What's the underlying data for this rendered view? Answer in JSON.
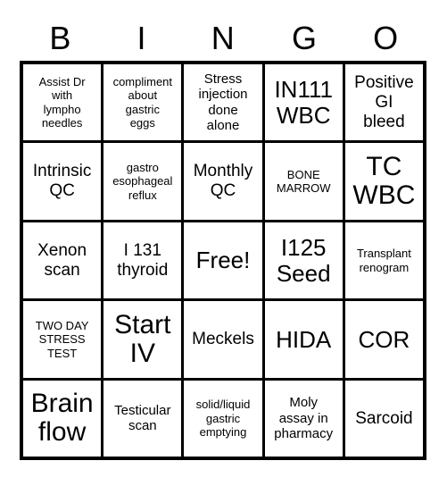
{
  "card": {
    "type": "bingo-card",
    "columns": 5,
    "rows": 5,
    "header": {
      "letters": [
        "B",
        "I",
        "N",
        "G",
        "O"
      ]
    },
    "colors": {
      "background": "#ffffff",
      "border": "#000000",
      "text": "#000000"
    },
    "free_space": {
      "label": "Free!",
      "row": 2,
      "column": 2
    },
    "cells": [
      [
        {
          "label": "Assist Dr\nwith\nlympho\nneedles",
          "size": "xs"
        },
        {
          "label": "compliment\nabout\ngastric\neggs",
          "size": "xs"
        },
        {
          "label": "Stress\ninjection\ndone\nalone",
          "size": "sm"
        },
        {
          "label": "IN111\nWBC",
          "size": "lg"
        },
        {
          "label": "Positive\nGI\nbleed",
          "size": "md"
        }
      ],
      [
        {
          "label": "Intrinsic\nQC",
          "size": "md"
        },
        {
          "label": "gastro\nesophageal\nreflux",
          "size": "xs"
        },
        {
          "label": "Monthly\nQC",
          "size": "md"
        },
        {
          "label": "BONE\nMARROW",
          "size": "xs"
        },
        {
          "label": "TC\nWBC",
          "size": "xl"
        }
      ],
      [
        {
          "label": "Xenon\nscan",
          "size": "md"
        },
        {
          "label": "I 131\nthyroid",
          "size": "md"
        },
        {
          "label": "Free!",
          "size": "lg"
        },
        {
          "label": "I125\nSeed",
          "size": "lg"
        },
        {
          "label": "Transplant\nrenogram",
          "size": "xs"
        }
      ],
      [
        {
          "label": "TWO DAY\nSTRESS\nTEST",
          "size": "xs"
        },
        {
          "label": "Start\nIV",
          "size": "xl"
        },
        {
          "label": "Meckels",
          "size": "md"
        },
        {
          "label": "HIDA",
          "size": "lg"
        },
        {
          "label": "COR",
          "size": "lg"
        }
      ],
      [
        {
          "label": "Brain\nflow",
          "size": "xl"
        },
        {
          "label": "Testicular\nscan",
          "size": "sm"
        },
        {
          "label": "solid/liquid\ngastric\nemptying",
          "size": "xs"
        },
        {
          "label": "Moly\nassay in\npharmacy",
          "size": "sm"
        },
        {
          "label": "Sarcoid",
          "size": "md"
        }
      ]
    ]
  }
}
